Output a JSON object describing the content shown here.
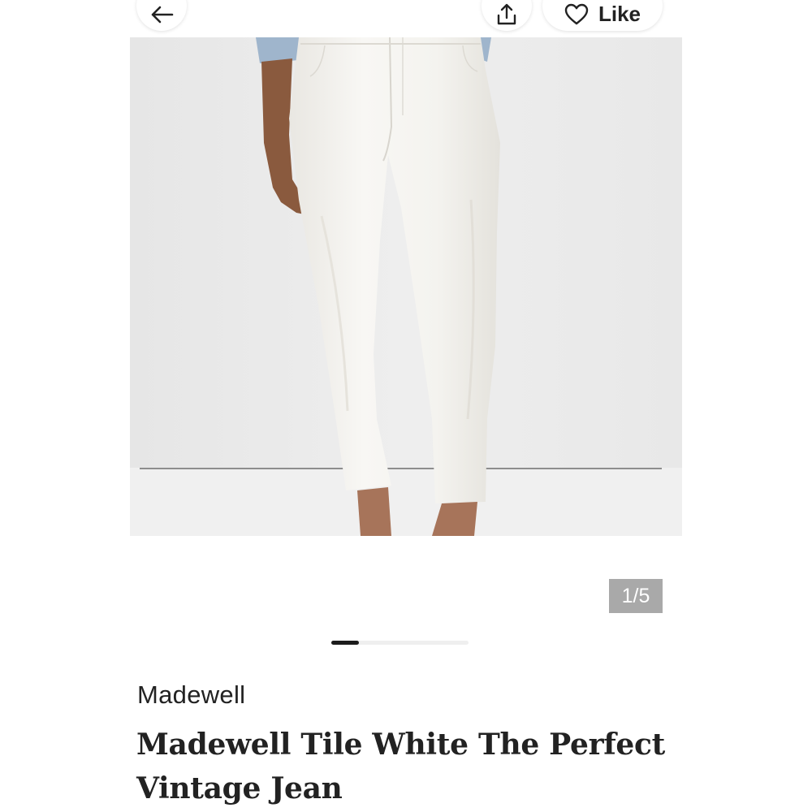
{
  "header": {
    "back_icon": "arrow-left-icon",
    "share_icon": "share-icon",
    "like_icon": "heart-icon",
    "like_label": "Like"
  },
  "gallery": {
    "counter": "1/5",
    "current_index": 1,
    "total": 5,
    "progress_fraction": 0.2
  },
  "product": {
    "brand": "Madewell",
    "title": "Madewell Tile White The Perfect Vintage Jean"
  },
  "colors": {
    "text": "#222222",
    "counter_bg": "#a9a9a9",
    "progress_active": "#1c1c1c",
    "progress_track": "#efefef"
  }
}
